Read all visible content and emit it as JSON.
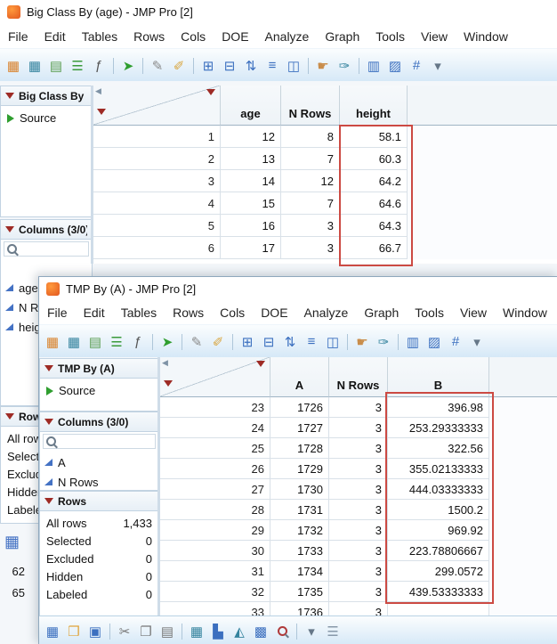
{
  "app": {
    "accent_blue": "#d5e8f7",
    "highlight_red": "#cc4a43"
  },
  "bg_window": {
    "title": "Big Class By (age) - JMP Pro [2]",
    "menu_items": [
      "File",
      "Edit",
      "Tables",
      "Rows",
      "Cols",
      "DOE",
      "Analyze",
      "Graph",
      "Tools",
      "View",
      "Window"
    ],
    "side": {
      "table_panel": {
        "title": "Big Class By (a...",
        "items": [
          {
            "label": "Source"
          }
        ]
      },
      "columns_panel": {
        "title": "Columns (3/0)",
        "items": [
          {
            "label": "age"
          },
          {
            "label": "N Rows"
          },
          {
            "label": "height"
          }
        ]
      },
      "rows_panel": {
        "title": "Rows",
        "stats": [
          {
            "label": "All rows"
          },
          {
            "label": "Selected"
          },
          {
            "label": "Excluded"
          },
          {
            "label": "Hidden"
          },
          {
            "label": "Labeled"
          }
        ]
      }
    },
    "table": {
      "columns": [
        "age",
        "N Rows",
        "height"
      ],
      "rows": [
        {
          "n": "1",
          "cells": [
            "12",
            "8",
            "58.1"
          ]
        },
        {
          "n": "2",
          "cells": [
            "13",
            "7",
            "60.3"
          ]
        },
        {
          "n": "3",
          "cells": [
            "14",
            "12",
            "64.2"
          ]
        },
        {
          "n": "4",
          "cells": [
            "15",
            "7",
            "64.6"
          ]
        },
        {
          "n": "5",
          "cells": [
            "16",
            "3",
            "64.3"
          ]
        },
        {
          "n": "6",
          "cells": [
            "17",
            "3",
            "66.7"
          ]
        }
      ]
    },
    "fragments": {
      "row_numbers": [
        "62",
        "65"
      ]
    }
  },
  "fg_window": {
    "title": "TMP By (A) - JMP Pro [2]",
    "menu_items": [
      "File",
      "Edit",
      "Tables",
      "Rows",
      "Cols",
      "DOE",
      "Analyze",
      "Graph",
      "Tools",
      "View",
      "Window"
    ],
    "side": {
      "table_panel": {
        "title": "TMP By (A)",
        "items": [
          {
            "label": "Source"
          }
        ]
      },
      "columns_panel": {
        "title": "Columns (3/0)",
        "items": [
          {
            "label": "A"
          },
          {
            "label": "N Rows"
          }
        ]
      },
      "rows_panel": {
        "title": "Rows",
        "stats": [
          {
            "label": "All rows",
            "value": "1,433"
          },
          {
            "label": "Selected",
            "value": "0"
          },
          {
            "label": "Excluded",
            "value": "0"
          },
          {
            "label": "Hidden",
            "value": "0"
          },
          {
            "label": "Labeled",
            "value": "0"
          }
        ]
      }
    },
    "table": {
      "columns": [
        "A",
        "N Rows",
        "B"
      ],
      "rows": [
        {
          "n": "23",
          "cells": [
            "1726",
            "3",
            "396.98"
          ]
        },
        {
          "n": "24",
          "cells": [
            "1727",
            "3",
            "253.29333333"
          ]
        },
        {
          "n": "25",
          "cells": [
            "1728",
            "3",
            "322.56"
          ]
        },
        {
          "n": "26",
          "cells": [
            "1729",
            "3",
            "355.02133333"
          ]
        },
        {
          "n": "27",
          "cells": [
            "1730",
            "3",
            "444.03333333"
          ]
        },
        {
          "n": "28",
          "cells": [
            "1731",
            "3",
            "1500.2"
          ]
        },
        {
          "n": "29",
          "cells": [
            "1732",
            "3",
            "969.92"
          ]
        },
        {
          "n": "30",
          "cells": [
            "1733",
            "3",
            "223.78806667"
          ]
        },
        {
          "n": "31",
          "cells": [
            "1734",
            "3",
            "299.0572"
          ]
        },
        {
          "n": "32",
          "cells": [
            "1735",
            "3",
            "439.53333333"
          ]
        },
        {
          "n": "33",
          "cells": [
            "1736",
            "3",
            ""
          ]
        }
      ]
    }
  },
  "toolbar_icons": [
    {
      "name": "new-data-table",
      "glyph": "▦",
      "color": "#d9822b"
    },
    {
      "name": "open-table",
      "glyph": "▦",
      "color": "#34839e"
    },
    {
      "name": "save-table",
      "glyph": "▤",
      "color": "#5b9e52"
    },
    {
      "name": "summary",
      "glyph": "☰",
      "color": "#3a9a3a"
    },
    {
      "name": "formula",
      "glyph": "ƒ",
      "color": "#555555"
    },
    {
      "sep": true
    },
    {
      "name": "run-script",
      "glyph": "➤",
      "color": "#2f9e2f"
    },
    {
      "sep": true
    },
    {
      "name": "annotate",
      "glyph": "✎",
      "color": "#8a8a8a"
    },
    {
      "name": "brush",
      "glyph": "✐",
      "color": "#d9a53d"
    },
    {
      "sep": true
    },
    {
      "name": "join-tables",
      "glyph": "⊞",
      "color": "#3b6fbf"
    },
    {
      "name": "update-table",
      "glyph": "⊟",
      "color": "#3b6fbf"
    },
    {
      "name": "sort-table",
      "glyph": "⇅",
      "color": "#3b6fbf"
    },
    {
      "name": "stack-columns",
      "glyph": "≡",
      "color": "#3b6fbf"
    },
    {
      "name": "split-columns",
      "glyph": "◫",
      "color": "#3b6fbf"
    },
    {
      "sep": true
    },
    {
      "name": "grabber-tool",
      "glyph": "☛",
      "color": "#c98d4b"
    },
    {
      "name": "pin-tool",
      "glyph": "✑",
      "color": "#34839e"
    },
    {
      "sep": true
    },
    {
      "name": "new-column",
      "glyph": "▥",
      "color": "#3b6fbf"
    },
    {
      "name": "column-pattern",
      "glyph": "▨",
      "color": "#3b6fbf"
    },
    {
      "name": "hash-grid",
      "glyph": "#",
      "color": "#3b6fbf"
    },
    {
      "name": "toolbar-overflow",
      "glyph": "▾",
      "color": "#667788"
    }
  ],
  "bottom_toolbar_icons": [
    {
      "name": "new-journal",
      "glyph": "▦",
      "color": "#3b6fbf"
    },
    {
      "name": "open-file",
      "glyph": "❒",
      "color": "#e0a53d"
    },
    {
      "name": "save-file",
      "glyph": "▣",
      "color": "#3b6fbf"
    },
    {
      "sep": true
    },
    {
      "name": "cut",
      "glyph": "✂",
      "color": "#777777"
    },
    {
      "name": "copy",
      "glyph": "❐",
      "color": "#777777"
    },
    {
      "name": "paste",
      "glyph": "▤",
      "color": "#777777"
    },
    {
      "sep": true
    },
    {
      "name": "data-table",
      "glyph": "▦",
      "color": "#34839e"
    },
    {
      "name": "graph-builder",
      "glyph": "▙",
      "color": "#3b6fbf"
    },
    {
      "name": "chart",
      "glyph": "◭",
      "color": "#34839e"
    },
    {
      "name": "grid-view",
      "glyph": "▩",
      "color": "#3b6fbf"
    },
    {
      "name": "zoom-tool",
      "mag": true,
      "color": "#b03a3a"
    },
    {
      "sep": true
    },
    {
      "name": "toolbar-overflow",
      "glyph": "▾",
      "color": "#667788"
    },
    {
      "name": "toolbar-handle",
      "glyph": "☰",
      "color": "#8899aa"
    }
  ]
}
